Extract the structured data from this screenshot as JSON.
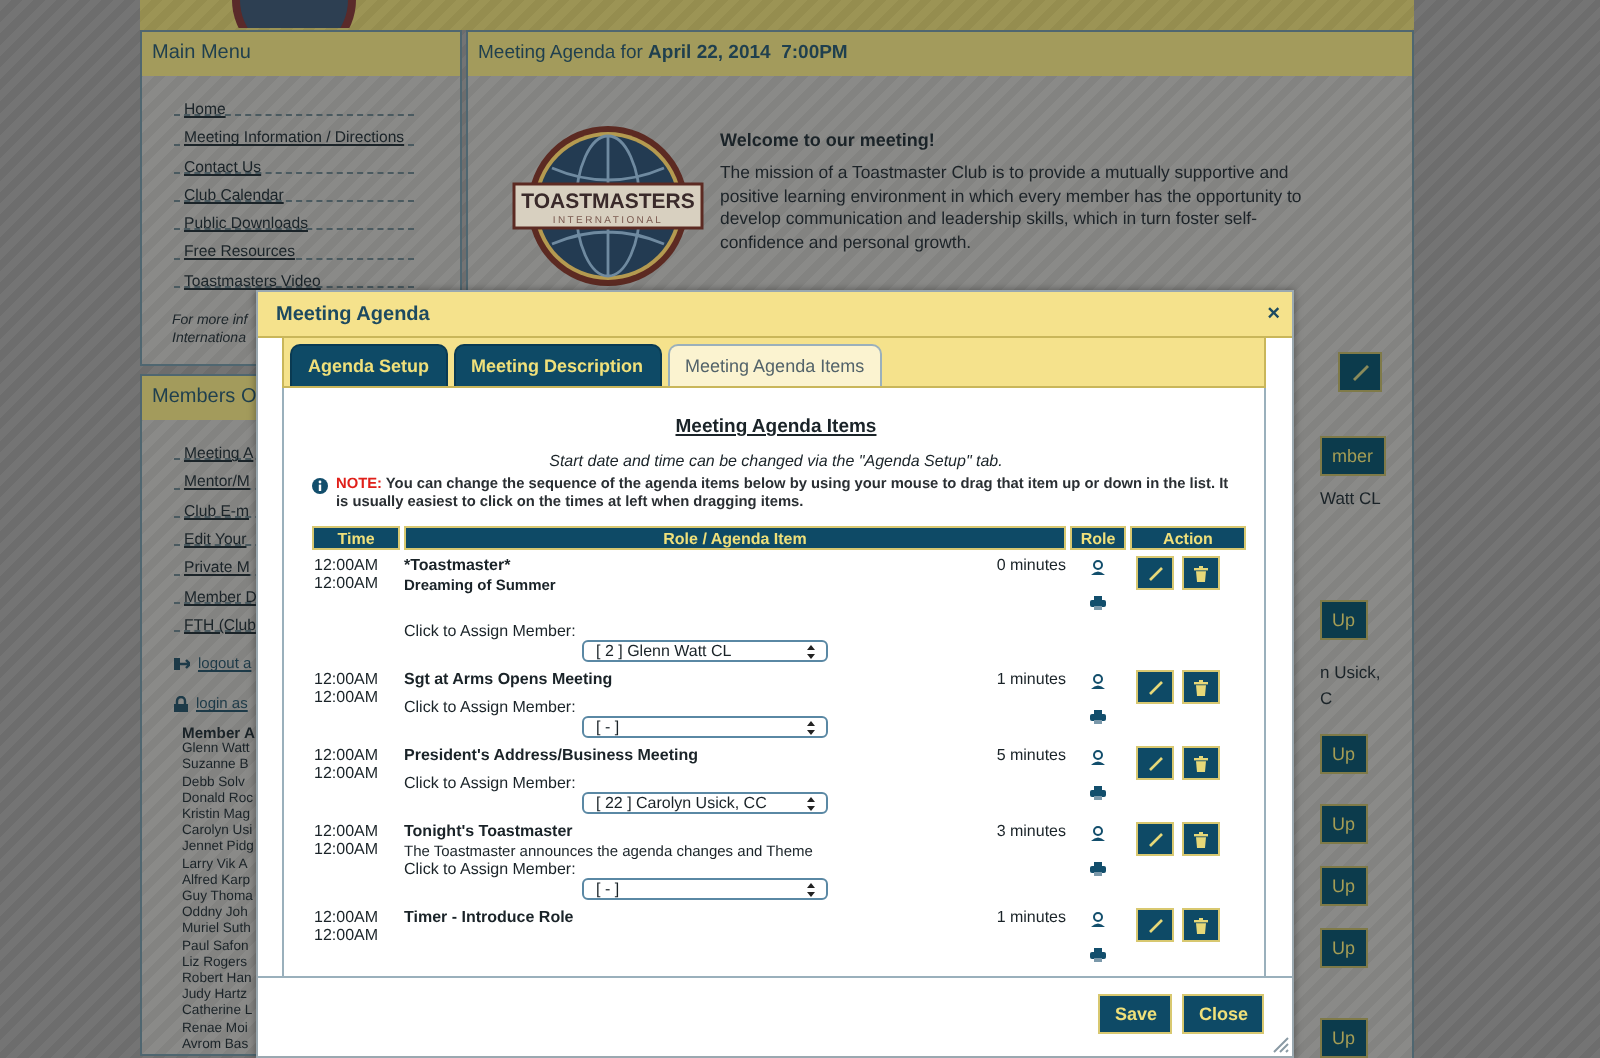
{
  "background": {
    "main_menu": {
      "title": "Main Menu",
      "items": [
        "Home",
        "Meeting Information / Directions",
        "Contact Us",
        "Club Calendar",
        "Public Downloads",
        "Free Resources",
        "Toastmasters Video"
      ],
      "note": [
        "For more inf",
        "Internationa"
      ]
    },
    "members_menu": {
      "title": "Members O",
      "items": [
        "Meeting A",
        "Mentor/M",
        "Club E-m",
        "Edit Your",
        "Private M",
        "Member D",
        "FTH (Club"
      ],
      "account_links": [
        {
          "kind": "logout",
          "label": "logout a"
        },
        {
          "kind": "login",
          "label": "login as"
        }
      ],
      "attendance_title": "Member A",
      "names": [
        "Glenn Watt",
        "Suzanne B",
        "Debb Solv",
        "Donald Roc",
        "Kristin Mag",
        "Carolyn Usi",
        "Jennet Pidg",
        "Larry Vik A",
        "Alfred Karp",
        "Guy Thoma",
        "Oddny Joh",
        "Muriel Suth",
        "Paul Safon",
        "Liz Rogers",
        "Robert Han",
        "Judy Hartz",
        "Catherine L",
        "Renae Moi",
        "Avrom Bas"
      ]
    },
    "agenda_panel": {
      "title": "Meeting Agenda for **April 22, 2014  7:00PM**",
      "logo": {
        "name": "TOASTMASTERS",
        "subtitle": "INTERNATIONAL"
      },
      "welcome_heading": "Welcome to our meeting!",
      "mission": "The mission of a Toastmaster Club is to provide a mutually supportive and positive learning environment in which every member has the opportunity to develop communication and leadership skills, which in turn foster self-confidence and personal growth."
    },
    "right_strip": [
      {
        "kind": "edit_button"
      },
      {
        "kind": "button",
        "label": "mber"
      },
      {
        "kind": "text",
        "text": "Watt CL"
      },
      {
        "kind": "button",
        "label": "Up"
      },
      {
        "kind": "text",
        "text": "n Usick,"
      },
      {
        "kind": "text",
        "text": "C"
      },
      {
        "kind": "button",
        "label": "Up"
      },
      {
        "kind": "button",
        "label": "Up"
      },
      {
        "kind": "button",
        "label": "Up"
      },
      {
        "kind": "button",
        "label": "Up"
      },
      {
        "kind": "button",
        "label": "Up"
      }
    ]
  },
  "modal": {
    "title": "Meeting Agenda",
    "close": "×",
    "tabs": [
      {
        "label": "Agenda Setup",
        "selected": false
      },
      {
        "label": "Meeting Description",
        "selected": false
      },
      {
        "label": "Meeting Agenda Items",
        "selected": true
      }
    ],
    "heading": "Meeting Agenda Items",
    "hint": "Start date and time can be changed via the \"Agenda Setup\" tab.",
    "note_label": "NOTE:",
    "note_text": "You can change the sequence of the agenda items below by using your mouse to drag that item up or down in the list. It is usually easiest to click on the times at left when dragging items.",
    "columns": [
      "Time",
      "Role / Agenda Item",
      "Role",
      "Action"
    ],
    "rows": [
      {
        "start": "12:00AM",
        "end": "12:00AM",
        "title": "*Toastmaster*",
        "description": "Dreaming of Summer",
        "description_bold": true,
        "duration": "0 minutes",
        "assign_label": "Click to Assign Member:",
        "member": "[ 2 ] Glenn Watt CL"
      },
      {
        "start": "12:00AM",
        "end": "12:00AM",
        "title": "Sgt at Arms Opens Meeting",
        "duration": "1 minutes",
        "assign_label": "Click to Assign Member:",
        "member": "[ - ]"
      },
      {
        "start": "12:00AM",
        "end": "12:00AM",
        "title": "President's Address/Business Meeting",
        "duration": "5 minutes",
        "assign_label": "Click to Assign Member:",
        "member": "[ 22 ] Carolyn Usick, CC"
      },
      {
        "start": "12:00AM",
        "end": "12:00AM",
        "title": "Tonight's Toastmaster",
        "description": "The Toastmaster announces the agenda changes and Theme",
        "description_bold": false,
        "duration": "3 minutes",
        "assign_label": "Click to Assign Member:",
        "member": "[ - ]"
      },
      {
        "start": "12:00AM",
        "end": "12:00AM",
        "title": "Timer - Introduce Role",
        "duration": "1 minutes"
      }
    ],
    "buttons": [
      "Save",
      "Close"
    ]
  }
}
